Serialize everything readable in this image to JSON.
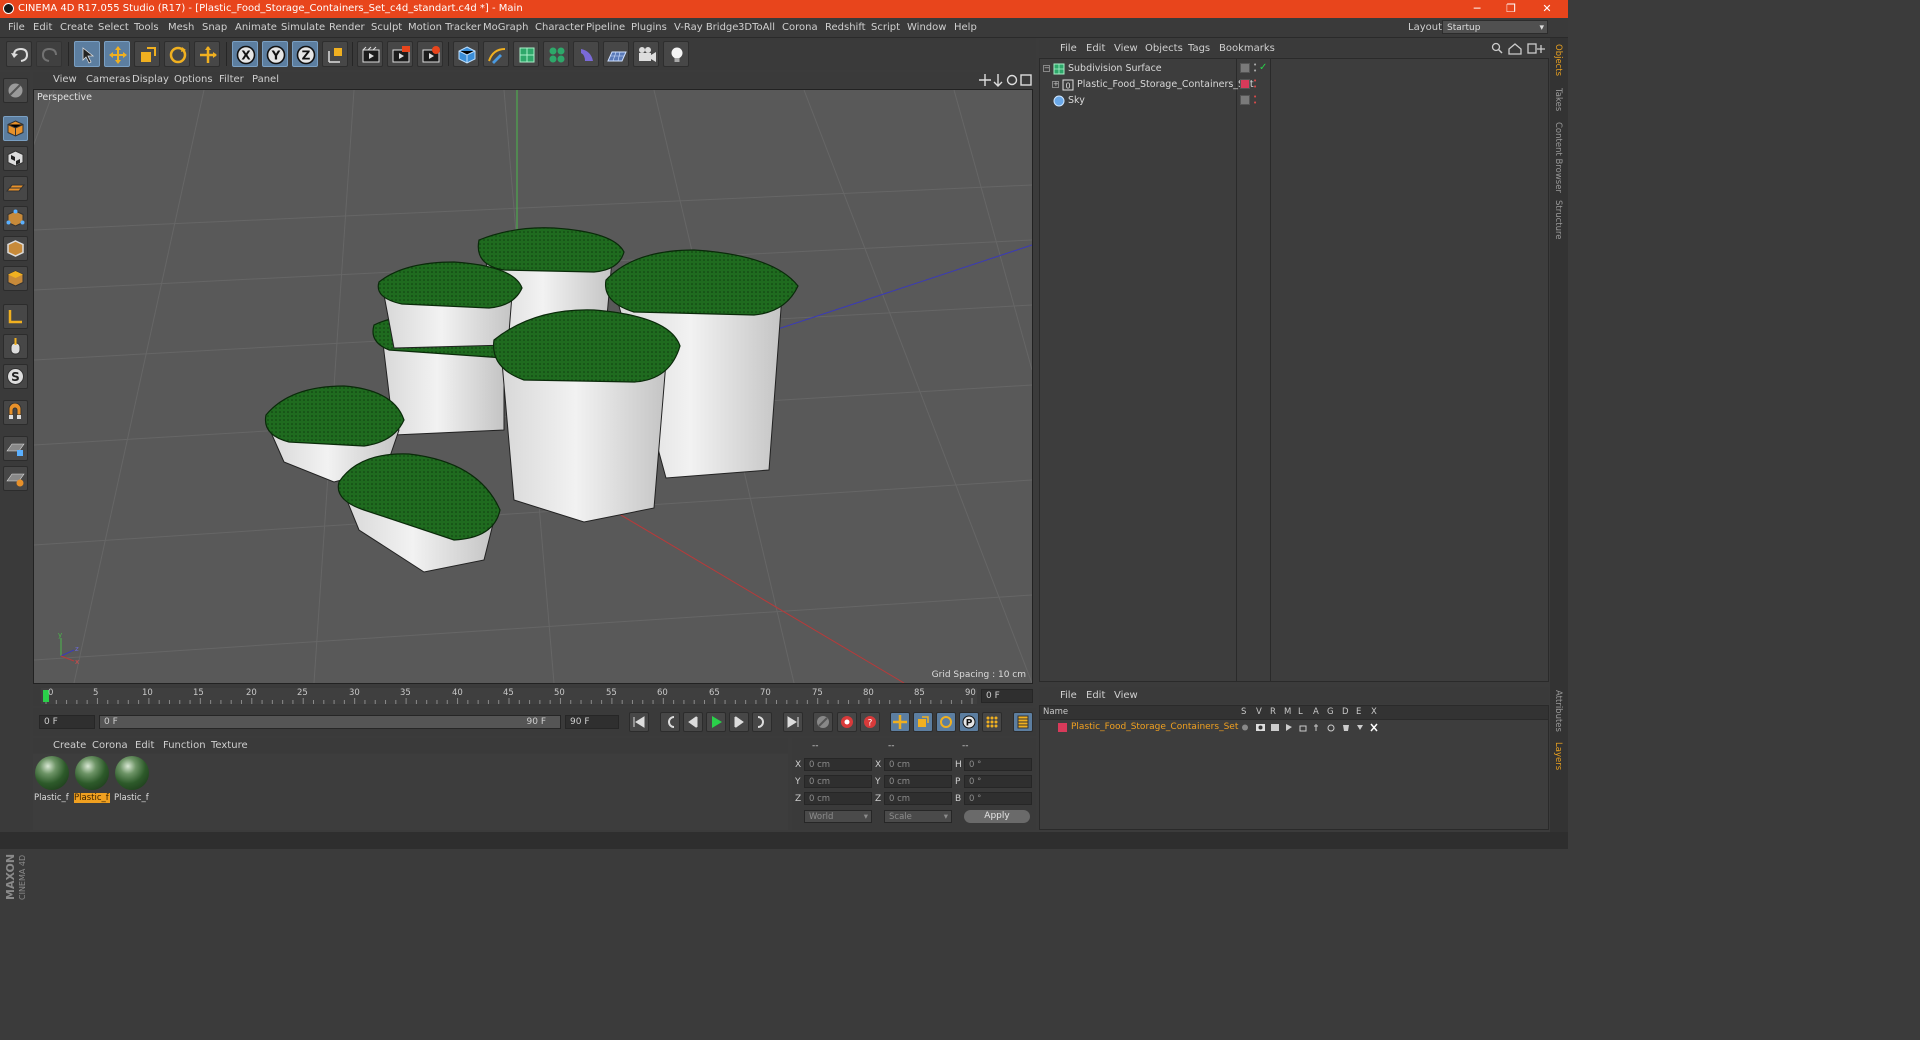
{
  "window": {
    "title": "CINEMA 4D R17.055 Studio (R17) - [Plastic_Food_Storage_Containers_Set_c4d_standart.c4d *] - Main",
    "minimize": "─",
    "restore": "❐",
    "close": "✕"
  },
  "menu": [
    "File",
    "Edit",
    "Create",
    "Select",
    "Tools",
    "Mesh",
    "Snap",
    "Animate",
    "Simulate",
    "Render",
    "Sculpt",
    "Motion Tracker",
    "MoGraph",
    "Character",
    "Pipeline",
    "Plugins",
    "V-Ray Bridge",
    "3DToAll",
    "Corona",
    "Redshift",
    "Script",
    "Window",
    "Help"
  ],
  "layout": {
    "label": "Layout:",
    "value": "Startup"
  },
  "viewport": {
    "menu": [
      "View",
      "Cameras",
      "Display",
      "Options",
      "Filter",
      "Panel"
    ],
    "label": "Perspective",
    "grid_spacing": "Grid Spacing : 10 cm"
  },
  "timeline": {
    "ticks": [
      "0",
      "5",
      "10",
      "15",
      "20",
      "25",
      "30",
      "35",
      "40",
      "45",
      "50",
      "55",
      "60",
      "65",
      "70",
      "75",
      "80",
      "85",
      "90"
    ],
    "current_frame": "0 F",
    "start": "0 F",
    "range_start": "0 F",
    "range_end": "90 F",
    "end": "90 F"
  },
  "material_panel": {
    "menu": [
      "Create",
      "Corona",
      "Edit",
      "Function",
      "Texture"
    ],
    "materials": [
      {
        "label": "Plastic_f",
        "selected": false
      },
      {
        "label": "Plastic_f",
        "selected": true
      },
      {
        "label": "Plastic_f",
        "selected": false
      }
    ]
  },
  "coordinates": {
    "headers": [
      "--",
      "--",
      "--"
    ],
    "rows": [
      {
        "l1": "X",
        "v1": "0 cm",
        "l2": "X",
        "v2": "0 cm",
        "l3": "H",
        "v3": "0 °"
      },
      {
        "l1": "Y",
        "v1": "0 cm",
        "l2": "Y",
        "v2": "0 cm",
        "l3": "P",
        "v3": "0 °"
      },
      {
        "l1": "Z",
        "v1": "0 cm",
        "l2": "Z",
        "v2": "0 cm",
        "l3": "B",
        "v3": "0 °"
      }
    ],
    "mode": "World",
    "scale": "Scale",
    "apply": "Apply"
  },
  "object_manager": {
    "menu": [
      "File",
      "Edit",
      "View",
      "Objects",
      "Tags",
      "Bookmarks"
    ],
    "objects": [
      {
        "name": "Subdivision Surface",
        "icon": "subdivision-icon"
      },
      {
        "name": "Plastic_Food_Storage_Containers_Set",
        "icon": "null-object-icon"
      },
      {
        "name": "Sky",
        "icon": "sky-icon"
      }
    ]
  },
  "layer_manager": {
    "menu": [
      "File",
      "Edit",
      "View"
    ],
    "columns": [
      "Name",
      "S",
      "V",
      "R",
      "M",
      "L",
      "A",
      "G",
      "D",
      "E",
      "X"
    ],
    "layer": "Plastic_Food_Storage_Containers_Set"
  },
  "side_tabs": [
    "Objects",
    "Takes",
    "Content Browser",
    "Structure",
    "Attributes",
    "Layers"
  ],
  "brand": {
    "line1": "MAXON",
    "line2": "CINEMA 4D"
  },
  "colors": {
    "title_bar": "#e8451c",
    "accent": "#f0a020",
    "lid_green": "#1f6b1f"
  }
}
